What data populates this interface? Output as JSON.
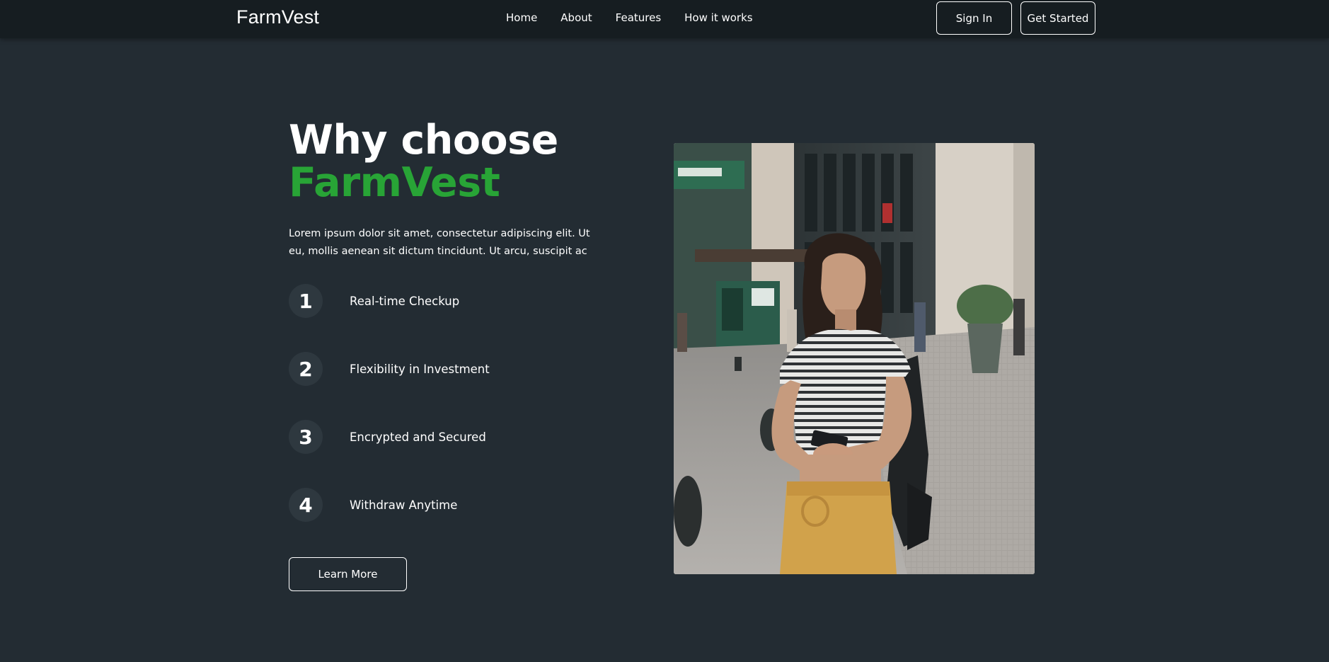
{
  "nav": {
    "logo": "FarmVest",
    "links": [
      "Home",
      "About",
      "Features",
      "How it works"
    ],
    "sign_in": "Sign In",
    "get_started": "Get Started"
  },
  "hero": {
    "title_line1": "Why choose",
    "title_line2": "FarmVest",
    "description": "Lorem ipsum dolor sit amet, consectetur adipiscing elit. Ut eu, mollis aenean sit dictum tincidunt. Ut arcu, suscipit ac",
    "features": [
      {
        "number": "1",
        "label": "Real-time Checkup"
      },
      {
        "number": "2",
        "label": "Flexibility in Investment"
      },
      {
        "number": "3",
        "label": "Encrypted and Secured"
      },
      {
        "number": "4",
        "label": "Withdraw Anytime"
      }
    ],
    "learn_more": "Learn More"
  },
  "colors": {
    "background": "#232c33",
    "navbar": "#161d21",
    "accent_green": "#28a436",
    "number_circle": "#2e383f"
  }
}
